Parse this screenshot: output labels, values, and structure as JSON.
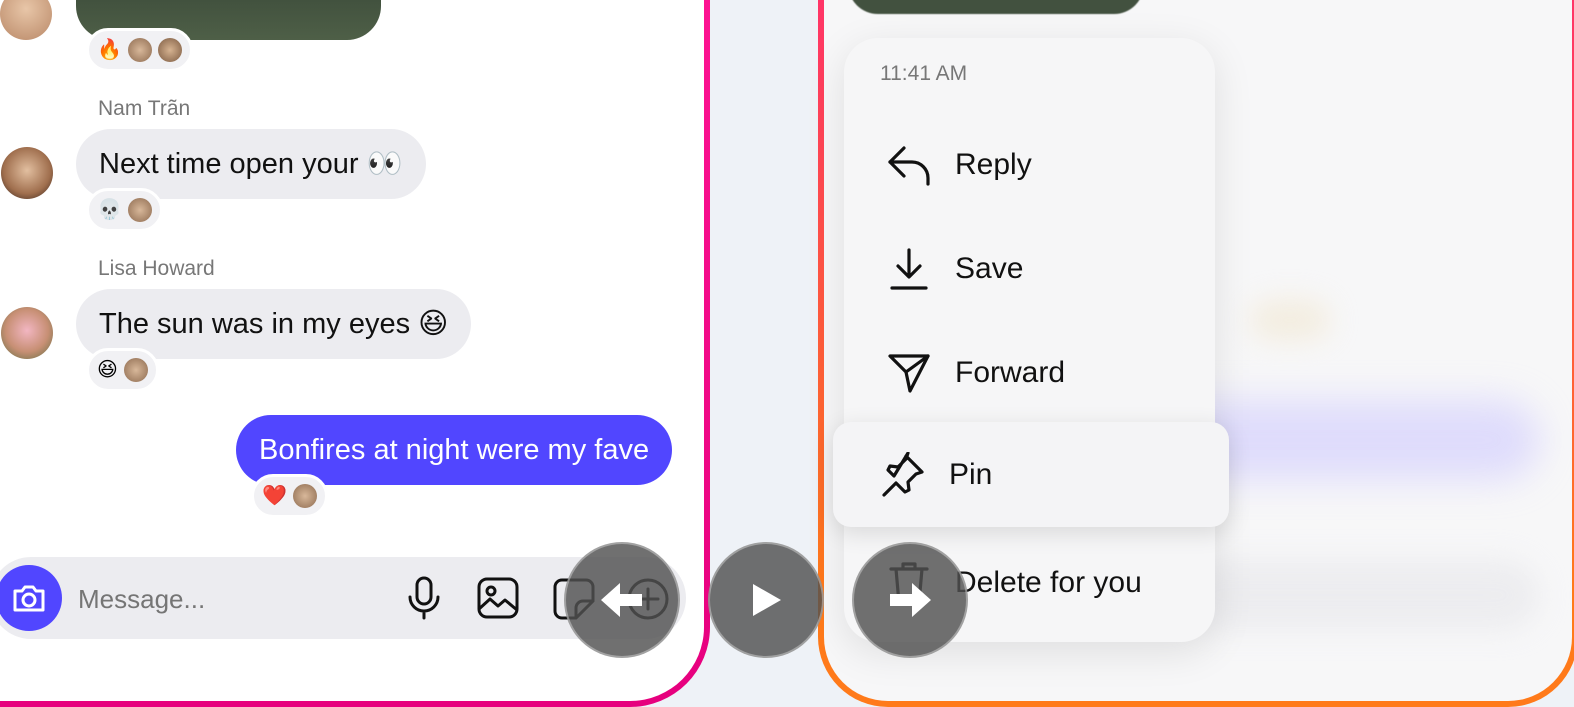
{
  "chat": {
    "messages": [
      {
        "sender": "Nam Trãn",
        "text": "Next time open your 👀",
        "reacts": [
          "💀"
        ]
      },
      {
        "sender": "Lisa Howard",
        "text": "The sun was in my eyes 😆",
        "reacts": [
          "😆"
        ]
      },
      {
        "sender": "",
        "text": "Bonfires at night were my fave",
        "reacts": [
          "❤️"
        ]
      }
    ],
    "top_reacts": [
      "🔥"
    ]
  },
  "composer": {
    "placeholder": "Message..."
  },
  "context_menu": {
    "timestamp": "11:41 AM",
    "items": [
      {
        "label": "Reply",
        "icon": "reply-icon"
      },
      {
        "label": "Save",
        "icon": "download-icon"
      },
      {
        "label": "Forward",
        "icon": "send-icon"
      },
      {
        "label": "Pin",
        "icon": "pin-icon"
      },
      {
        "label": "Delete for you",
        "icon": "trash-icon"
      }
    ]
  },
  "colors": {
    "accent": "#5146FF",
    "frame_left": "#FF1493",
    "frame_right": "#FF7A1A"
  }
}
